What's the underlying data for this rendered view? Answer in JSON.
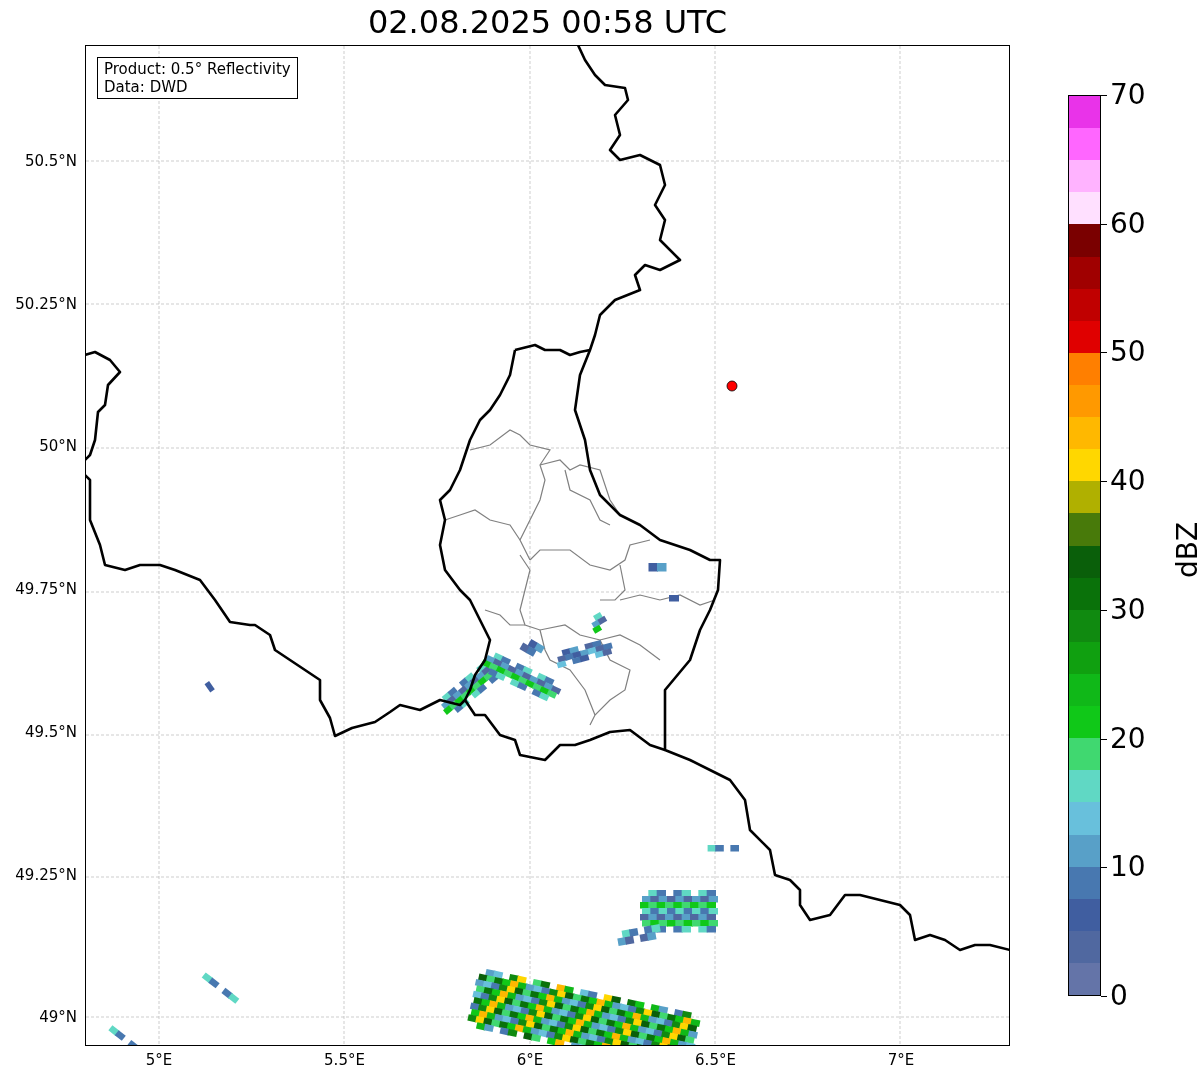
{
  "title": "02.08.2025 00:58 UTC",
  "info_box": [
    "Product: 0.5° Reflectivity",
    "Data: DWD"
  ],
  "lat_labels": [
    "50.5°N",
    "50.25°N",
    "50°N",
    "49.75°N",
    "49.5°N",
    "49.25°N",
    "49°N"
  ],
  "lon_labels": [
    "5°E",
    "5.5°E",
    "6°E",
    "6.5°E",
    "7°E"
  ],
  "colorbar": {
    "label": "dBZ",
    "ticks": [
      "70",
      "60",
      "50",
      "40",
      "30",
      "20",
      "10",
      "0"
    ],
    "segments": [
      {
        "color": "#e933e9"
      },
      {
        "color": "#ff66ff"
      },
      {
        "color": "#ffb3ff"
      },
      {
        "color": "#ffe0ff"
      },
      {
        "color": "#7a0000"
      },
      {
        "color": "#a00000"
      },
      {
        "color": "#c00000"
      },
      {
        "color": "#e00000"
      },
      {
        "color": "#ff7f00"
      },
      {
        "color": "#ff9900"
      },
      {
        "color": "#ffb800"
      },
      {
        "color": "#ffd700"
      },
      {
        "color": "#b0b000"
      },
      {
        "color": "#487a0a"
      },
      {
        "color": "#0a5f0a"
      },
      {
        "color": "#0a720a"
      },
      {
        "color": "#108a10"
      },
      {
        "color": "#10a010"
      },
      {
        "color": "#10b818"
      },
      {
        "color": "#10c818"
      },
      {
        "color": "#40d870"
      },
      {
        "color": "#60d8c4"
      },
      {
        "color": "#68c0dc"
      },
      {
        "color": "#58a0c8"
      },
      {
        "color": "#4878b0"
      },
      {
        "color": "#405ea0"
      },
      {
        "color": "#5068a0"
      },
      {
        "color": "#6474a8"
      }
    ]
  }
}
